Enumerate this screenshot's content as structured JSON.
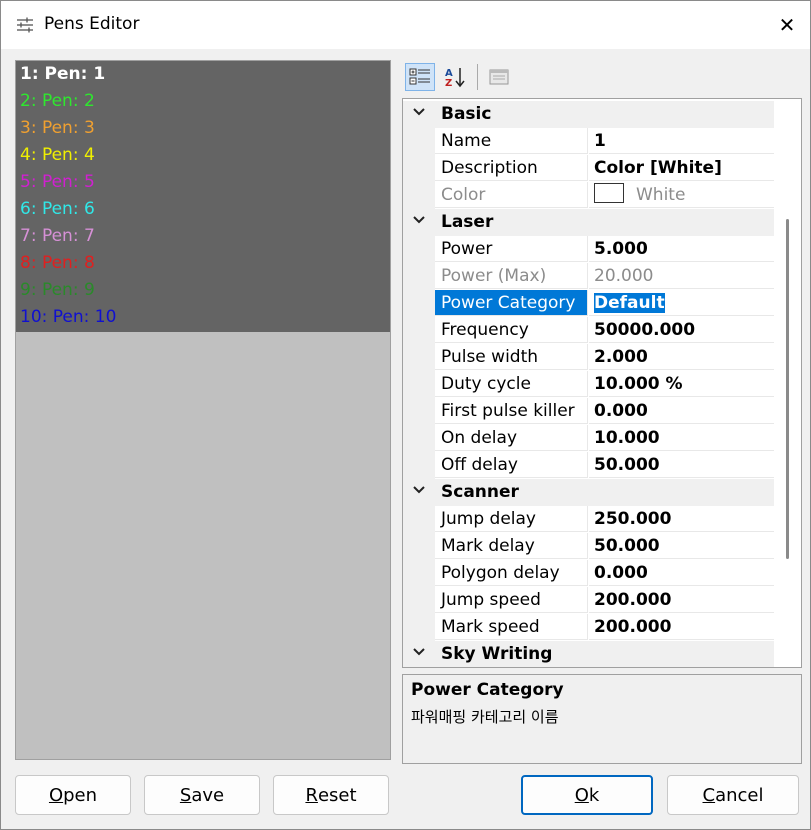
{
  "window": {
    "title": "Pens Editor",
    "close_glyph": "✕"
  },
  "pens": [
    {
      "label": "1: Pen: 1",
      "color": "#ffffff",
      "selected": true
    },
    {
      "label": "2: Pen: 2",
      "color": "#2ee82e"
    },
    {
      "label": "3: Pen: 3",
      "color": "#f0a030"
    },
    {
      "label": "4: Pen: 4",
      "color": "#f0f000"
    },
    {
      "label": "5: Pen: 5",
      "color": "#d020d0"
    },
    {
      "label": "6: Pen: 6",
      "color": "#30e8e8"
    },
    {
      "label": "7: Pen: 7",
      "color": "#d690d6"
    },
    {
      "label": "8: Pen: 8",
      "color": "#e02020"
    },
    {
      "label": "9: Pen: 9",
      "color": "#2a8a2a"
    },
    {
      "label": "10: Pen: 10",
      "color": "#1010d0"
    }
  ],
  "toolbar": {
    "categorized_icon": "categorized-icon",
    "alphabetical_icon": "sort-az-icon",
    "property_pages_icon": "property-pages-icon"
  },
  "properties": [
    {
      "category": "Basic"
    },
    {
      "name": "Name",
      "value": "1"
    },
    {
      "name": "Description",
      "value": "Color [White]"
    },
    {
      "name": "Color",
      "value": "White",
      "readonly": true,
      "swatch": "#ffffff"
    },
    {
      "category": "Laser"
    },
    {
      "name": "Power",
      "value": "5.000"
    },
    {
      "name": "Power (Max)",
      "value": "20.000",
      "readonly": true
    },
    {
      "name": "Power Category",
      "value": "Default",
      "highlight": true
    },
    {
      "name": "Frequency",
      "value": "50000.000"
    },
    {
      "name": "Pulse width",
      "value": "2.000"
    },
    {
      "name": "Duty cycle",
      "value": "10.000 %"
    },
    {
      "name": "First pulse killer",
      "value": "0.000"
    },
    {
      "name": "On delay",
      "value": "10.000"
    },
    {
      "name": "Off delay",
      "value": "50.000"
    },
    {
      "category": "Scanner"
    },
    {
      "name": "Jump delay",
      "value": "250.000"
    },
    {
      "name": "Mark delay",
      "value": "50.000"
    },
    {
      "name": "Polygon delay",
      "value": "0.000"
    },
    {
      "name": "Jump speed",
      "value": "200.000"
    },
    {
      "name": "Mark speed",
      "value": "200.000"
    },
    {
      "category": "Sky Writing"
    }
  ],
  "description": {
    "title": "Power Category",
    "text": "파워매핑 카테고리 이름"
  },
  "buttons": {
    "open": {
      "mnemonic": "O",
      "rest": "pen"
    },
    "save": {
      "mnemonic": "S",
      "rest": "ave"
    },
    "reset": {
      "mnemonic": "R",
      "rest": "eset"
    },
    "ok": {
      "mnemonic": "O",
      "rest": "k"
    },
    "cancel": {
      "mnemonic": "C",
      "rest": "ancel"
    }
  }
}
